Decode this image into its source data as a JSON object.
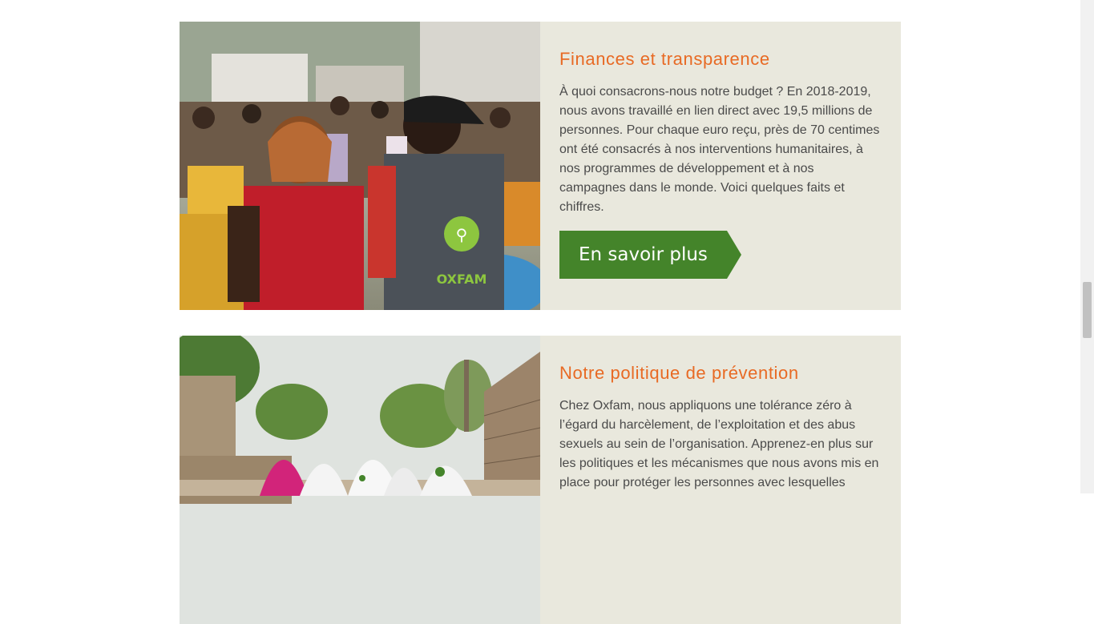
{
  "cards": [
    {
      "title": "Finances et transparence",
      "text": "À quoi consacrons-nous notre budget ? En 2018-2019, nous avons travaillé en lien direct avec 19,5 millions de personnes. Pour chaque euro reçu, près de 70 centimes ont été consacrés à nos interventions humanitaires, à nos programmes de développement et à nos campagnes dans le monde. Voici quelques faits et chiffres.",
      "button_label": "En savoir plus",
      "photo_vest_text": "OXFAM"
    },
    {
      "title": "Notre politique de prévention",
      "text": "Chez Oxfam, nous appliquons une tolérance zéro à l’égard du harcèlement, de l’exploitation et des abus sexuels au sein de l’organisation. Apprenez-en plus sur les politiques et les mécanismes que nous avons mis en place pour protéger les personnes avec lesquelles"
    }
  ],
  "colors": {
    "title": "#e86a24",
    "panel_bg": "#e9e8dd",
    "button_bg": "#44842a",
    "text": "#4a4a4a"
  }
}
